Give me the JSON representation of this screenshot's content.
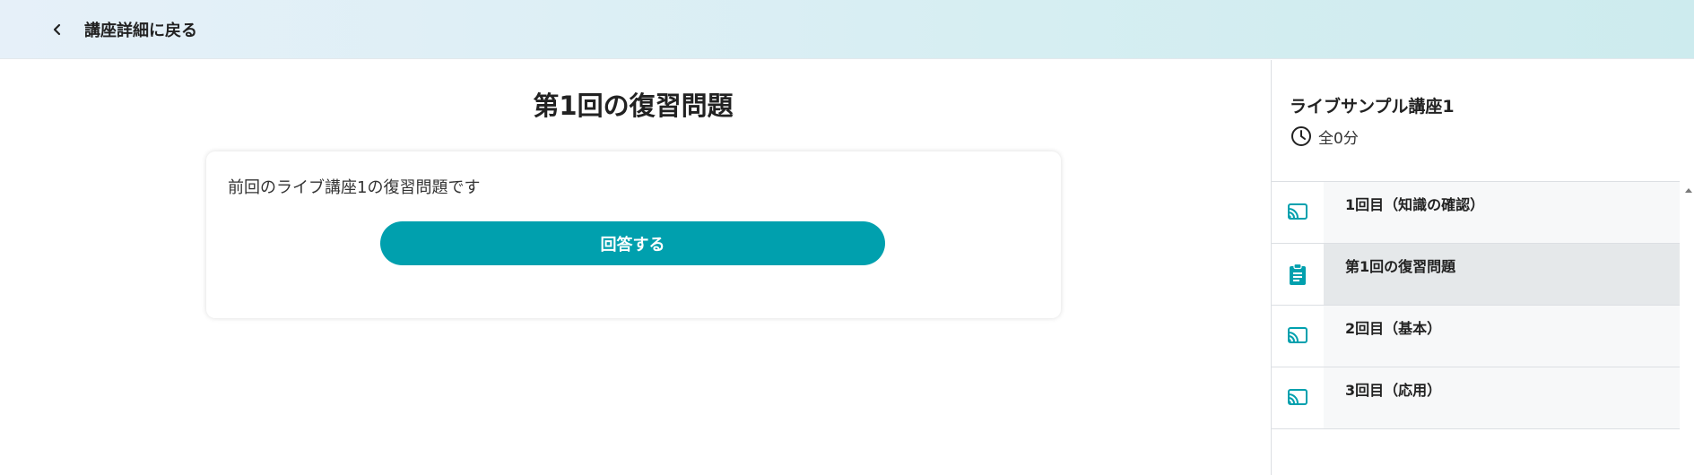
{
  "header": {
    "back_label": "講座詳細に戻る"
  },
  "main": {
    "title": "第1回の復習問題",
    "card": {
      "description": "前回のライブ講座1の復習問題です",
      "answer_button": "回答する"
    }
  },
  "sidebar": {
    "course_title": "ライブサンプル講座1",
    "duration": "全0分",
    "lessons": [
      {
        "label": "1回目（知識の確認）",
        "icon": "cast-icon",
        "active": false
      },
      {
        "label": "第1回の復習問題",
        "icon": "clipboard-icon",
        "active": true
      },
      {
        "label": "2回目（基本）",
        "icon": "cast-icon",
        "active": false
      },
      {
        "label": "3回目（応用）",
        "icon": "cast-icon",
        "active": false
      }
    ]
  },
  "colors": {
    "accent": "#00a0ae",
    "header_gradient_start": "#e6f0f9",
    "header_gradient_end": "#cdebee",
    "active_row": "#e5e8ea"
  }
}
